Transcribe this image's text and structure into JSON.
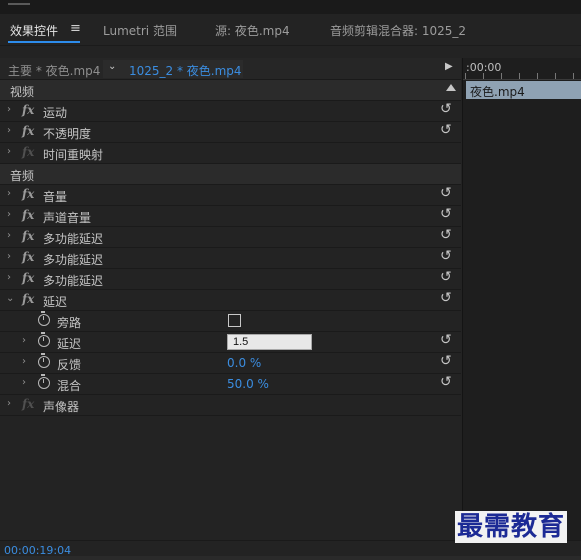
{
  "tabs": [
    {
      "label": "效果控件",
      "active": true
    },
    {
      "label": "Lumetri 范围",
      "active": false
    },
    {
      "label": "源: 夜色.mp4",
      "active": false
    },
    {
      "label": "音频剪辑混合器: 1025_2",
      "active": false
    }
  ],
  "tab_menu_icon": "hamburger-menu-icon",
  "clip_bar": {
    "master": "主要 * 夜色.mp4",
    "sequence": "1025_2 * 夜色.mp4"
  },
  "timeline": {
    "ruler": ":00:00",
    "clip_name": "夜色.mp4"
  },
  "rows": [
    {
      "type": "section",
      "label": "视频"
    },
    {
      "type": "effect",
      "label": "运动"
    },
    {
      "type": "effect",
      "label": "不透明度"
    },
    {
      "type": "effect",
      "label": "时间重映射",
      "disabled": true
    },
    {
      "type": "section",
      "label": "音频"
    },
    {
      "type": "effect",
      "label": "音量"
    },
    {
      "type": "effect",
      "label": "声道音量"
    },
    {
      "type": "effect",
      "label": "多功能延迟"
    },
    {
      "type": "effect",
      "label": "多功能延迟"
    },
    {
      "type": "effect",
      "label": "多功能延迟"
    },
    {
      "type": "effect",
      "label": "延迟",
      "expanded": true
    },
    {
      "type": "param",
      "label": "旁路",
      "control": "checkbox",
      "checked": false
    },
    {
      "type": "param",
      "label": "延迟",
      "control": "input",
      "value": "1.5"
    },
    {
      "type": "param",
      "label": "反馈",
      "control": "value",
      "value": "0.0 %"
    },
    {
      "type": "param",
      "label": "混合",
      "control": "value",
      "value": "50.0 %"
    },
    {
      "type": "effect",
      "label": "声像器",
      "disabled": true
    }
  ],
  "timecode": "00:00:19:04",
  "watermark": "最需教育",
  "colors": {
    "accent_blue": "#3b8de0",
    "panel_bg": "#232323",
    "clip_block": "#8fa2b3",
    "watermark": "#1c2a95"
  }
}
